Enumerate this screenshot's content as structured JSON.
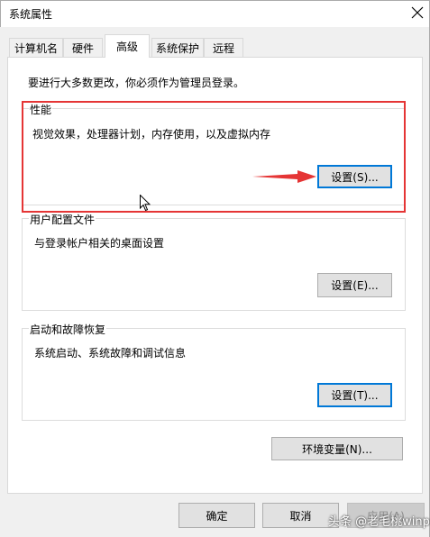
{
  "window": {
    "title": "系统属性"
  },
  "tabs": [
    {
      "label": "计算机名",
      "active": false
    },
    {
      "label": "硬件",
      "active": false
    },
    {
      "label": "高级",
      "active": true
    },
    {
      "label": "系统保护",
      "active": false
    },
    {
      "label": "远程",
      "active": false
    }
  ],
  "notice": "要进行大多数更改，你必须作为管理员登录。",
  "performance": {
    "legend": "性能",
    "description": "视觉效果，处理器计划，内存使用，以及虚拟内存",
    "button": "设置(S)..."
  },
  "user_profiles": {
    "legend": "用户配置文件",
    "description": "与登录帐户相关的桌面设置",
    "button": "设置(E)..."
  },
  "startup_recovery": {
    "legend": "启动和故障恢复",
    "description": "系统启动、系统故障和调试信息",
    "button": "设置(T)..."
  },
  "env_button": "环境变量(N)...",
  "footer": {
    "ok": "确定",
    "cancel": "取消",
    "apply": "应用(A)"
  },
  "watermark": "头条 @老毛桃winpe",
  "colors": {
    "annotation": "#e53535",
    "focus": "#0078d7",
    "surface": "#f0f0f0"
  },
  "icons": {
    "close": "close-icon",
    "pointer": "mouse-pointer-icon",
    "arrow": "annotation-arrow-icon"
  }
}
